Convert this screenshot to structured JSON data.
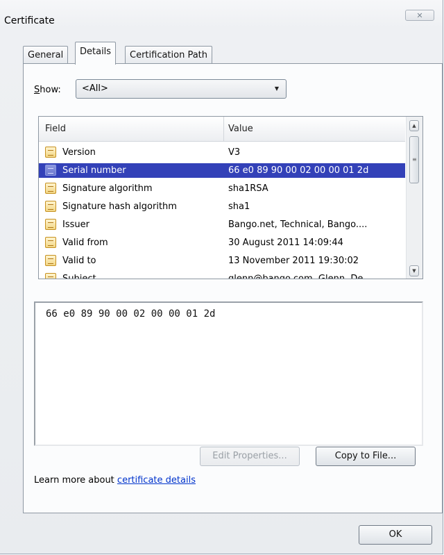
{
  "window": {
    "title": "Certificate",
    "close_glyph": "✕"
  },
  "tabs": [
    {
      "label": "General"
    },
    {
      "label": "Details"
    },
    {
      "label": "Certification Path"
    }
  ],
  "show": {
    "label_prefix": "S",
    "label_rest": "how:",
    "selected": "<All>"
  },
  "list": {
    "headers": {
      "field": "Field",
      "value": "Value"
    },
    "rows": [
      {
        "field": "Version",
        "value": "V3"
      },
      {
        "field": "Serial number",
        "value": "66 e0 89 90 00 02 00 00 01 2d"
      },
      {
        "field": "Signature algorithm",
        "value": "sha1RSA"
      },
      {
        "field": "Signature hash algorithm",
        "value": "sha1"
      },
      {
        "field": "Issuer",
        "value": "Bango.net, Technical, Bango...."
      },
      {
        "field": "Valid from",
        "value": "30 August 2011 14:09:44"
      },
      {
        "field": "Valid to",
        "value": "13 November 2011 19:30:02"
      },
      {
        "field": "Subject",
        "value": "glenn@bango.com, Glenn, De..."
      }
    ]
  },
  "detail_value": "66 e0 89 90 00 02 00 00 01 2d",
  "buttons": {
    "edit_properties": "Edit Properties...",
    "copy_to_file": "Copy to File...",
    "ok": "OK"
  },
  "learn": {
    "text": "Learn more about ",
    "link": "certificate details"
  },
  "colors": {
    "selection": "#3341b8",
    "link": "#0033cc"
  }
}
